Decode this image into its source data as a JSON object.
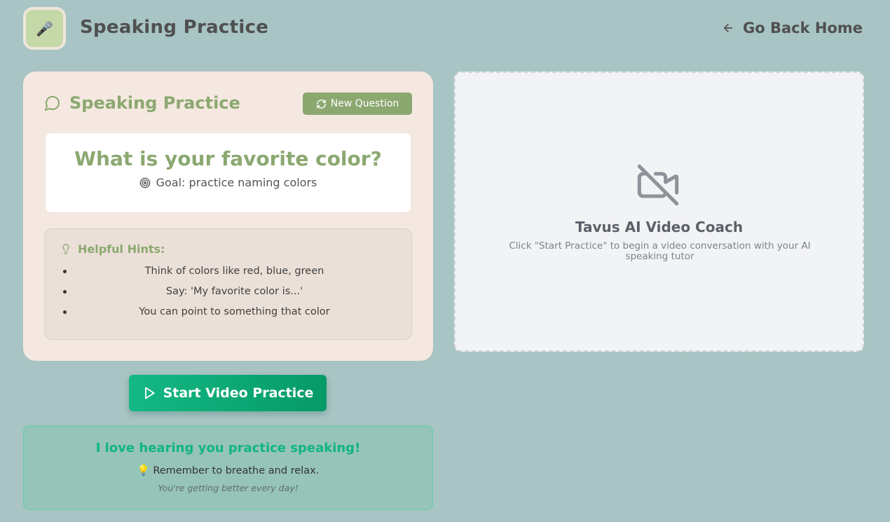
{
  "header": {
    "logo_icon": "microphone-icon",
    "logo_glyph": "🎤",
    "title": "Speaking Practice",
    "back_label": "Go Back Home"
  },
  "practice_card": {
    "title": "Speaking Practice",
    "new_question_label": "New Question",
    "question": "What is your favorite color?",
    "goal": "Goal: practice naming colors",
    "hints_title": "Helpful Hints:",
    "hints": [
      "Think of colors like red, blue, green",
      "Say: 'My favorite color is...'",
      "You can point to something that color"
    ]
  },
  "start_button_label": "Start Video Practice",
  "encouragement": {
    "title": "I love hearing you practice speaking!",
    "tip_glyph": "💡",
    "tip": "Remember to breathe and relax.",
    "subtext": "You're getting better every day!"
  },
  "video_panel": {
    "icon": "video-off-icon",
    "title": "Tavus AI Video Coach",
    "description": "Click \"Start Practice\" to begin a video conversation with your AI speaking tutor"
  },
  "colors": {
    "background": "#a8c4c4",
    "accent_green": "#8ba870",
    "start_button": "#0fa874",
    "encourage_text": "#10b57f",
    "card_bg": "#f5e8e0"
  }
}
